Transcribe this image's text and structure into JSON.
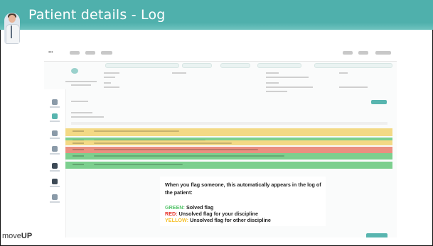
{
  "slide": {
    "title": "Patient details - Log",
    "logo_prefix": "move",
    "logo_suffix": "UP"
  },
  "colors": {
    "header": "#4fb0ac",
    "green": "#56c46b",
    "red": "#e7342b",
    "yellow": "#f6c12b",
    "row_yellow": "#f3d985",
    "row_green": "#7ccf8e",
    "row_red": "#ea8f80",
    "teal_button": "#58b5af"
  },
  "app_screenshot": {
    "log_rows": [
      {
        "status": "yellow"
      },
      {
        "status": "green"
      },
      {
        "status": "yellow"
      },
      {
        "status": "red"
      },
      {
        "status": "green"
      },
      {
        "status": "green"
      }
    ]
  },
  "legend": {
    "intro": "When you flag someone, this automatically appears in the log of the patient:",
    "items": [
      {
        "key": "GREEN:",
        "text": " Solved flag",
        "color": "green"
      },
      {
        "key": "RED:",
        "text": " Unsolved flag for your discipline",
        "color": "red"
      },
      {
        "key": "YELLOW:",
        "text": " Unsolved flag for other discipline",
        "color": "yellow"
      }
    ]
  }
}
